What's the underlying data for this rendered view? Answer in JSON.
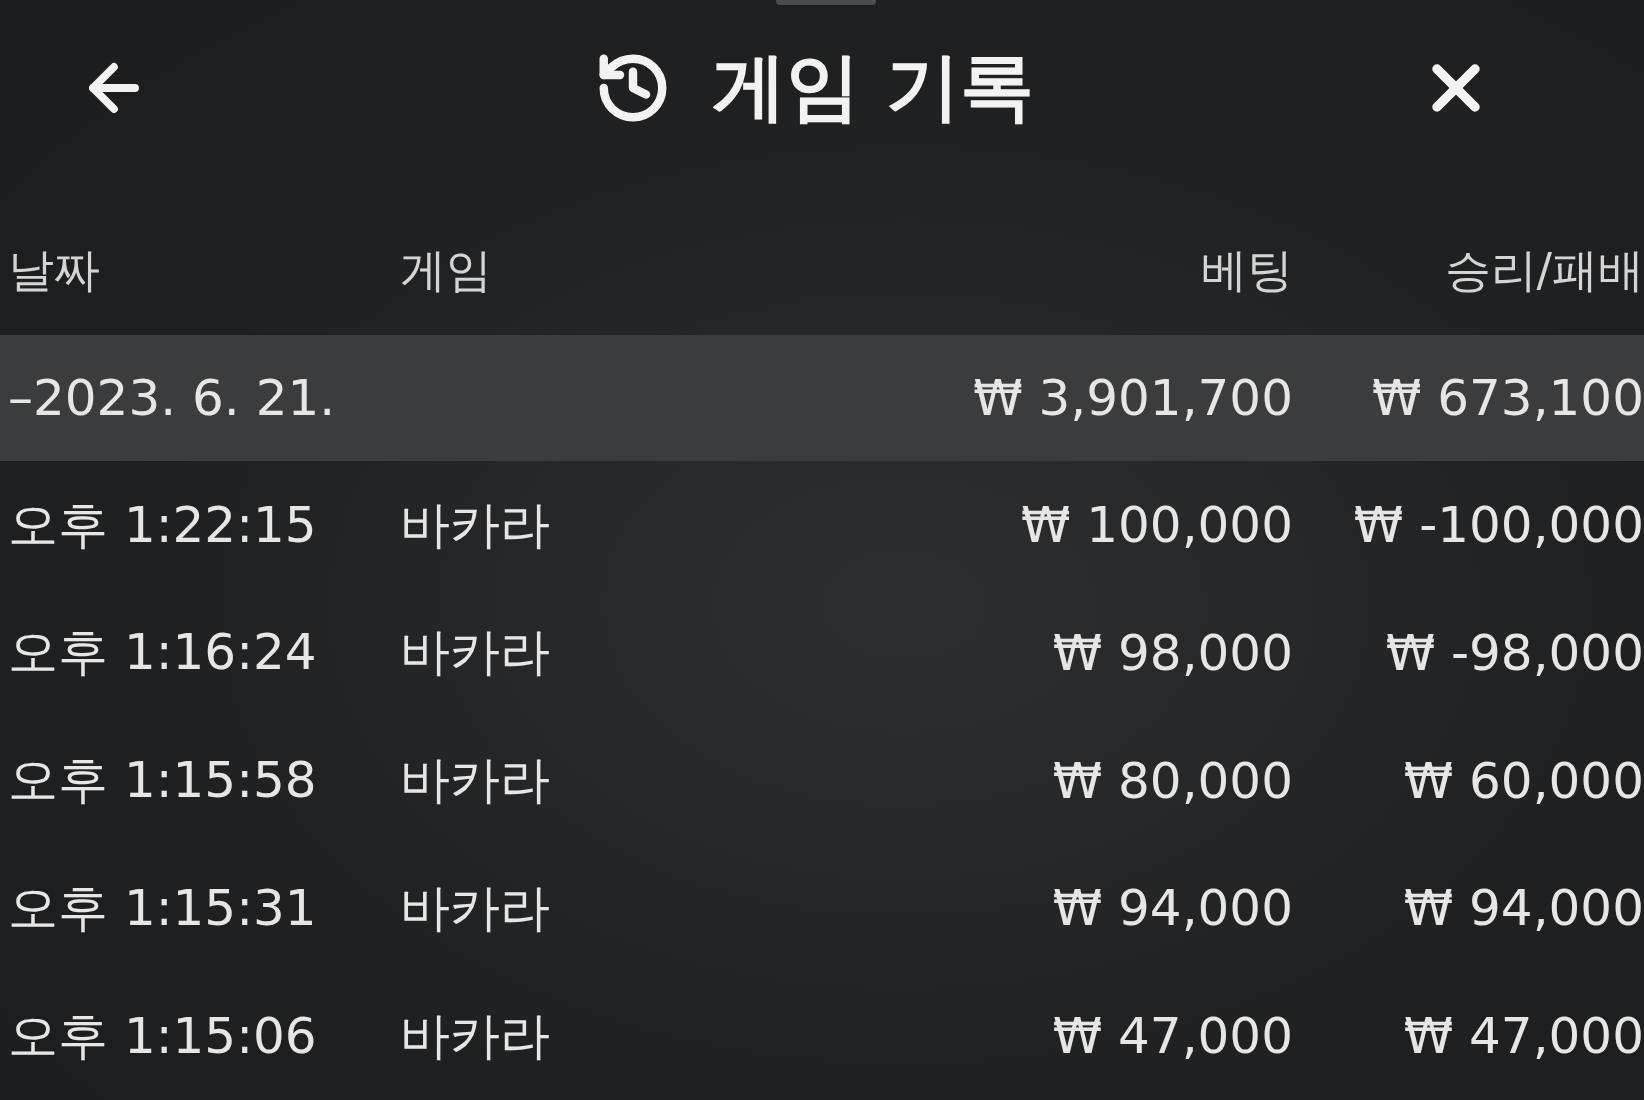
{
  "header": {
    "title": "게임 기록"
  },
  "columns": [
    "날짜",
    "게임",
    "베팅",
    "승리/패배"
  ],
  "groups": [
    {
      "marker": "–",
      "date": "2023. 6. 21.",
      "bet": "₩ 3,901,700",
      "result": "₩ 673,100",
      "expanded": true,
      "rows": [
        {
          "time": "오후 1:22:15",
          "game": "바카라",
          "bet": "₩ 100,000",
          "result": "₩ -100,000"
        },
        {
          "time": "오후 1:16:24",
          "game": "바카라",
          "bet": "₩ 98,000",
          "result": "₩ -98,000"
        },
        {
          "time": "오후 1:15:58",
          "game": "바카라",
          "bet": "₩ 80,000",
          "result": "₩ 60,000"
        },
        {
          "time": "오후 1:15:31",
          "game": "바카라",
          "bet": "₩ 94,000",
          "result": "₩ 94,000"
        },
        {
          "time": "오후 1:15:06",
          "game": "바카라",
          "bet": "₩ 47,000",
          "result": "₩ 47,000"
        }
      ]
    }
  ]
}
